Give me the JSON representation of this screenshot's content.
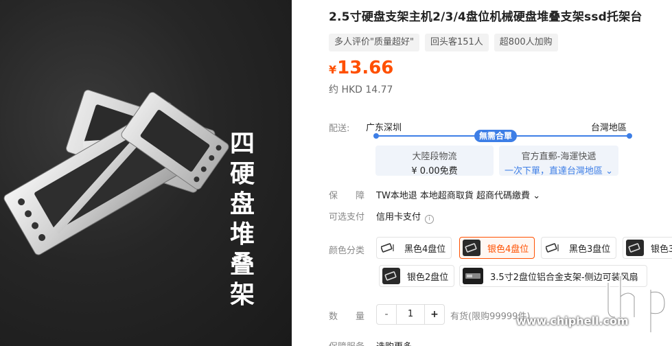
{
  "photo": {
    "vertical_text": [
      "四",
      "硬",
      "盘",
      "堆",
      "叠",
      "架"
    ]
  },
  "product": {
    "title": "2.5寸硬盘支架主机2/3/4盘位机械硬盘堆叠支架ssd托架台",
    "tags": [
      "多人评价\"质量超好\"",
      "回头客151人",
      "超800人加购"
    ],
    "price_currency": "¥",
    "price": "13.66",
    "hkd_price": "约 HKD 14.77",
    "price_color": "#ff5000"
  },
  "shipping": {
    "label": "配送:",
    "from": "广东深圳",
    "to": "台灣地區",
    "badge": "無需合單",
    "accent_color": "#3d7ee6",
    "segments": [
      {
        "line1": "大陸段物流",
        "line2": "¥ 0.00免费"
      },
      {
        "line1": "官方直郵-海運快遞",
        "line2": "一次下單，直達台灣地區 ⌄"
      }
    ]
  },
  "guarantee": {
    "label": "保　　障",
    "value": "TW本地退 本地超商取貨 超商代碼繳費 ⌄"
  },
  "payment": {
    "label": "可选支付",
    "value": "信用卡支付",
    "info_icon": "ⓘ"
  },
  "color": {
    "label": "颜色分类",
    "options": [
      {
        "label": "黑色4盘位",
        "thumb_icon": "bracket-icon"
      },
      {
        "label": "银色4盘位",
        "thumb_icon": "bracket-icon",
        "selected": true
      },
      {
        "label": "黑色3盘位",
        "thumb_icon": "bracket-icon"
      },
      {
        "label": "银色3",
        "thumb_icon": "bracket-icon"
      },
      {
        "label": "银色2盘位",
        "thumb_icon": "bracket-icon"
      },
      {
        "label": "3.5寸2盘位铝合金支架-侧边可装风扇",
        "thumb_icon": "enclosure-icon"
      }
    ]
  },
  "quantity": {
    "label": "数　　量",
    "minus": "-",
    "value": "1",
    "plus": "+",
    "stock": "有货(限购99999件)"
  },
  "more": {
    "label": "保障服务",
    "value": "选购更多 ⌄"
  },
  "watermark": {
    "text": "www.chiphell.com"
  }
}
